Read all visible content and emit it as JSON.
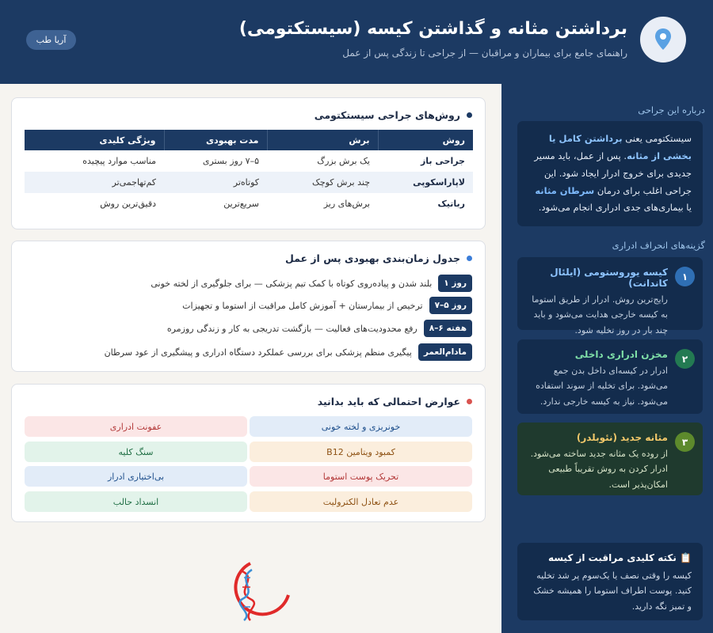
{
  "header": {
    "title": "برداشتن مثانه و گذاشتن کیسه (سیستکتومی)",
    "subtitle": "راهنمای جامع برای بیماران و مراقبان — از جراحی تا زندگی پس از عمل",
    "brand_button": "آریا طب"
  },
  "sidebar": {
    "about_heading": "درباره این جراحی",
    "about_text": {
      "p1": "سیستکتومی یعنی",
      "h1": "برداشتن کامل یا بخشی از مثانه",
      "p2": ". پس از عمل، باید مسیر جدیدی برای خروج ادرار ایجاد شود. این جراحی اغلب برای درمان",
      "h2": "سرطان مثانه",
      "p3": "یا بیماری‌های جدی ادراری انجام می‌شود."
    },
    "types_heading": "گزینه‌های انحراف ادراری",
    "types": [
      {
        "num": "۱",
        "title": "کیسه یوروستومی (ایلئال کاندانت)",
        "desc": "رایج‌ترین روش. ادرار از طریق استوما به کیسه خارجی هدایت می‌شود و باید چند بار در روز تخلیه شود."
      },
      {
        "num": "۲",
        "title": "مخزن ادراری داخلی",
        "desc": "ادرار در کیسه‌ای داخل بدن جمع می‌شود. برای تخلیه از سوند استفاده می‌شود. نیاز به کیسه خارجی ندارد."
      },
      {
        "num": "۳",
        "title": "مثانه جدید (نئوبلدر)",
        "desc": "از روده یک مثانه جدید ساخته می‌شود. ادرار کردن به روش تقریباً طبیعی امکان‌پذیر است."
      }
    ],
    "tip": {
      "title": "📋 نکته کلیدی مراقبت از کیسه",
      "text": "کیسه را وقتی نصف یا یک‌سوم پر شد تخلیه کنید. پوست اطراف استوما را همیشه خشک و تمیز نگه دارید."
    }
  },
  "methods_table": {
    "heading": "روش‌های جراحی سیستکتومی",
    "columns": [
      "روش",
      "برش",
      "مدت بهبودی",
      "ویژگی کلیدی"
    ],
    "rows": [
      [
        "جراحی باز",
        "یک برش بزرگ",
        "۵–۷ روز بستری",
        "مناسب موارد پیچیده"
      ],
      [
        "لاپاراسکوپی",
        "چند برش کوچک",
        "کوتاه‌تر",
        "کم‌تهاجمی‌تر"
      ],
      [
        "رباتیک",
        "برش‌های ریز",
        "سریع‌ترین",
        "دقیق‌ترین روش"
      ]
    ]
  },
  "timeline": {
    "heading": "جدول زمان‌بندی بهبودی پس از عمل",
    "items": [
      {
        "badge": "روز ۱",
        "text": "بلند شدن و پیاده‌روی کوتاه با کمک تیم پزشکی — برای جلوگیری از لخته خونی"
      },
      {
        "badge": "روز ۵–۷",
        "text": "ترخیص از بیمارستان + آموزش کامل مراقبت از استوما و تجهیزات"
      },
      {
        "badge": "هفته ۶–۸",
        "text": "رفع محدودیت‌های فعالیت — بازگشت تدریجی به کار و زندگی روزمره"
      },
      {
        "badge": "مادام‌العمر",
        "text": "پیگیری منظم پزشکی برای بررسی عملکرد دستگاه ادراری و پیشگیری از عود سرطان"
      }
    ]
  },
  "complications": {
    "heading": "عوارض احتمالی که باید بدانید",
    "items": [
      {
        "label": "خونریزی و لخته خونی",
        "color": "blue"
      },
      {
        "label": "عفونت ادراری",
        "color": "red"
      },
      {
        "label": "کمبود ویتامین B12",
        "color": "orange"
      },
      {
        "label": "سنگ کلیه",
        "color": "green"
      },
      {
        "label": "تحریک پوست استوما",
        "color": "red"
      },
      {
        "label": "بی‌اختیاری ادرار",
        "color": "blue"
      },
      {
        "label": "عدم تعادل الکترولیت",
        "color": "orange"
      },
      {
        "label": "انسداد حالب",
        "color": "green"
      }
    ]
  },
  "colors": {
    "navy": "#1c3a63",
    "sidebar_card": "#132c4d",
    "accent_blue": "#7fbbff",
    "bullet_red": "#d9534f",
    "bullet_blue": "#3b7dd8"
  },
  "icons": {
    "header_logo": "location-pin-icon",
    "bottom_logo": "dna-helix-logo"
  }
}
